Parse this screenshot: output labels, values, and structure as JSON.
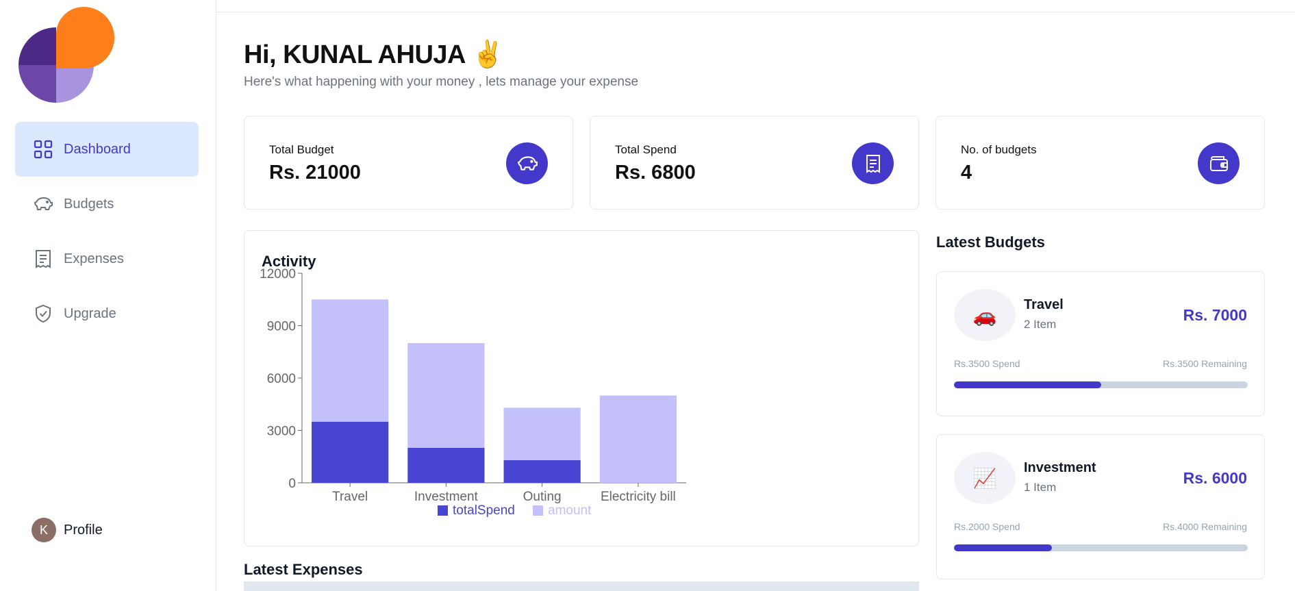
{
  "sidebar": {
    "items": [
      {
        "label": "Dashboard",
        "icon": "grid-icon",
        "active": true
      },
      {
        "label": "Budgets",
        "icon": "piggy-bank-icon",
        "active": false
      },
      {
        "label": "Expenses",
        "icon": "receipt-icon",
        "active": false
      },
      {
        "label": "Upgrade",
        "icon": "shield-check-icon",
        "active": false
      }
    ],
    "profile": {
      "initial": "K",
      "label": "Profile"
    }
  },
  "header": {
    "greeting": "Hi, KUNAL AHUJA ✌️",
    "subtitle": "Here's what happening with your money , lets manage your expense"
  },
  "stats": [
    {
      "label": "Total Budget",
      "value": "Rs. 21000",
      "icon": "piggy-bank-icon"
    },
    {
      "label": "Total Spend",
      "value": "Rs. 6800",
      "icon": "receipt-icon"
    },
    {
      "label": "No. of budgets",
      "value": "4",
      "icon": "wallet-icon"
    }
  ],
  "activity": {
    "title": "Activity"
  },
  "chart_data": {
    "type": "bar",
    "stacked": true,
    "categories": [
      "Travel",
      "Investment",
      "Outing",
      "Electricity bill"
    ],
    "series": [
      {
        "name": "totalSpend",
        "values": [
          3500,
          2000,
          1300,
          0
        ],
        "color": "#4845d2"
      },
      {
        "name": "amount",
        "values": [
          7000,
          6000,
          3000,
          5000
        ],
        "color": "#c3c0fb"
      }
    ],
    "yticks": [
      0,
      3000,
      6000,
      9000,
      12000
    ],
    "ylim": [
      0,
      12000
    ],
    "legend_position": "bottom-center"
  },
  "latest_budgets": {
    "title": "Latest Budgets",
    "items": [
      {
        "emoji": "🚗",
        "name": "Travel",
        "items": "2 Item",
        "amount": "Rs. 7000",
        "spend": "Rs.3500 Spend",
        "remaining": "Rs.3500 Remaining",
        "progress": 0.5
      },
      {
        "emoji": "📈",
        "name": "Investment",
        "items": "1 Item",
        "amount": "Rs. 6000",
        "spend": "Rs.2000 Spend",
        "remaining": "Rs.4000 Remaining",
        "progress": 0.333
      }
    ]
  },
  "latest_expenses": {
    "title": "Latest Expenses"
  },
  "colors": {
    "accent": "#4338ca",
    "active_bg": "#dbe8fd",
    "bar_light": "#c3c0fb",
    "logo_orange": "#fd7e1a",
    "logo_purple": "#4c2a85"
  }
}
